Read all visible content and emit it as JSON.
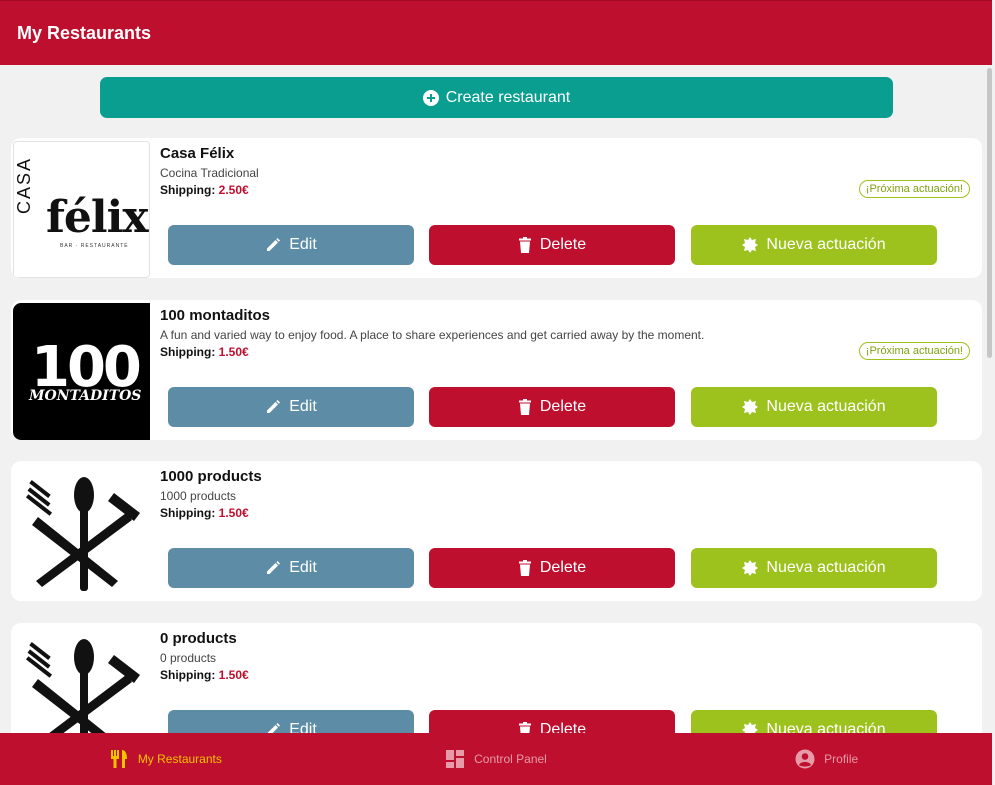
{
  "header": {
    "title": "My Restaurants"
  },
  "actions": {
    "create_label": "Create restaurant"
  },
  "restaurants": [
    {
      "name": "Casa Félix",
      "description": "Cocina Tradicional",
      "shipping_label": "Shipping:",
      "shipping_value": "2.50€",
      "badge": "¡Próxima actuación!",
      "logo": {
        "type": "felix",
        "line1": "CASA",
        "line2": "félix",
        "tagline": "BAR · RESTAURANTE"
      }
    },
    {
      "name": "100 montaditos",
      "description": "A fun and varied way to enjoy food. A place to share experiences and get carried away by the moment.",
      "shipping_label": "Shipping:",
      "shipping_value": "1.50€",
      "badge": "¡Próxima actuación!",
      "logo": {
        "type": "montaditos",
        "line1": "100",
        "line2": "MONTADITOS"
      }
    },
    {
      "name": "1000 products",
      "description": "1000 products",
      "shipping_label": "Shipping:",
      "shipping_value": "1.50€",
      "logo": {
        "type": "cutlery-icon"
      }
    },
    {
      "name": "0 products",
      "description": "0 products",
      "shipping_label": "Shipping:",
      "shipping_value": "1.50€",
      "logo": {
        "type": "cutlery-icon"
      }
    }
  ],
  "card_buttons": {
    "edit": "Edit",
    "delete": "Delete",
    "nueva": "Nueva actuación"
  },
  "tabs": [
    {
      "label": "My Restaurants",
      "icon": "utensils-icon",
      "active": true
    },
    {
      "label": "Control Panel",
      "icon": "dashboard-icon",
      "active": false
    },
    {
      "label": "Profile",
      "icon": "user-circle-icon",
      "active": false
    }
  ],
  "colors": {
    "brand": "#be0f2e",
    "teal": "#0a9e90",
    "edit": "#5d8ca6",
    "nueva": "#9dc21d",
    "active_tab": "#f3c300"
  }
}
